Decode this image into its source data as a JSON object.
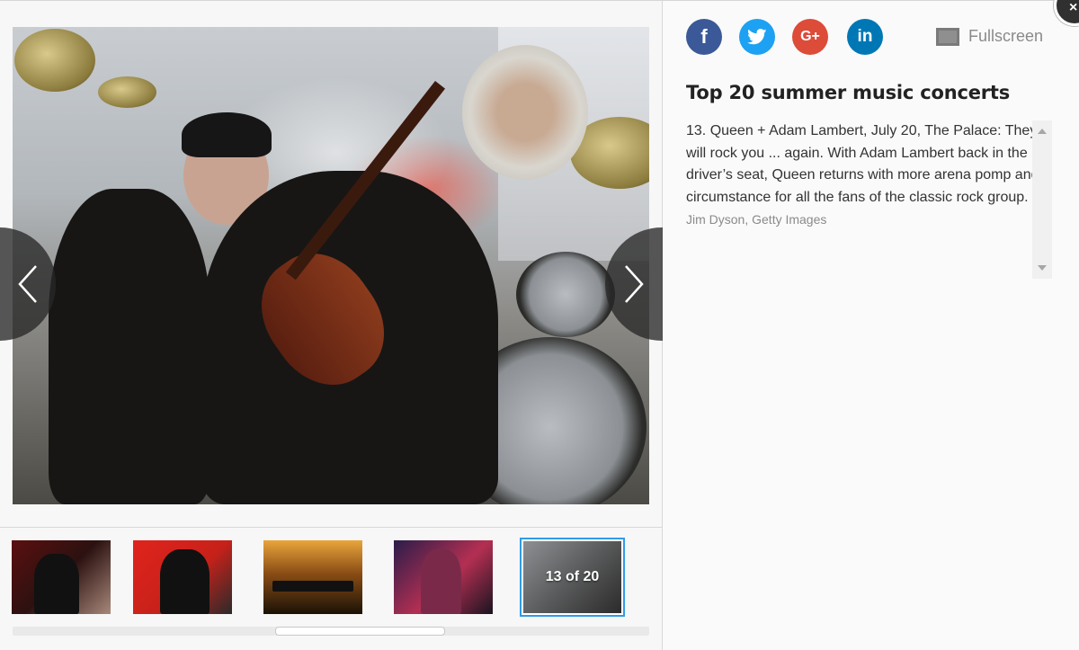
{
  "gallery": {
    "title": "Top 20 summer music concerts",
    "counter": "13 of 20",
    "caption": "13. Queen + Adam Lambert, July 20, The Palace: They will rock you ... again. With Adam Lambert back in the driver’s seat, Queen returns with more arena pomp and circumstance for all the fans of the classic rock group.",
    "credit": "Jim Dyson, Getty Images"
  },
  "toolbar": {
    "fullscreen_label": "Fullscreen"
  },
  "share": {
    "facebook": "f",
    "googleplus": "G+",
    "linkedin": "in"
  },
  "close_label": "×",
  "colors": {
    "facebook": "#3b5998",
    "twitter": "#1da1f2",
    "googleplus": "#dd4b39",
    "linkedin": "#0077b5",
    "active_thumb_border": "#2f9ce8"
  },
  "icons": [
    "facebook-icon",
    "twitter-icon",
    "googleplus-icon",
    "linkedin-icon",
    "fullscreen-icon",
    "chevron-left-icon",
    "chevron-right-icon",
    "close-icon"
  ]
}
